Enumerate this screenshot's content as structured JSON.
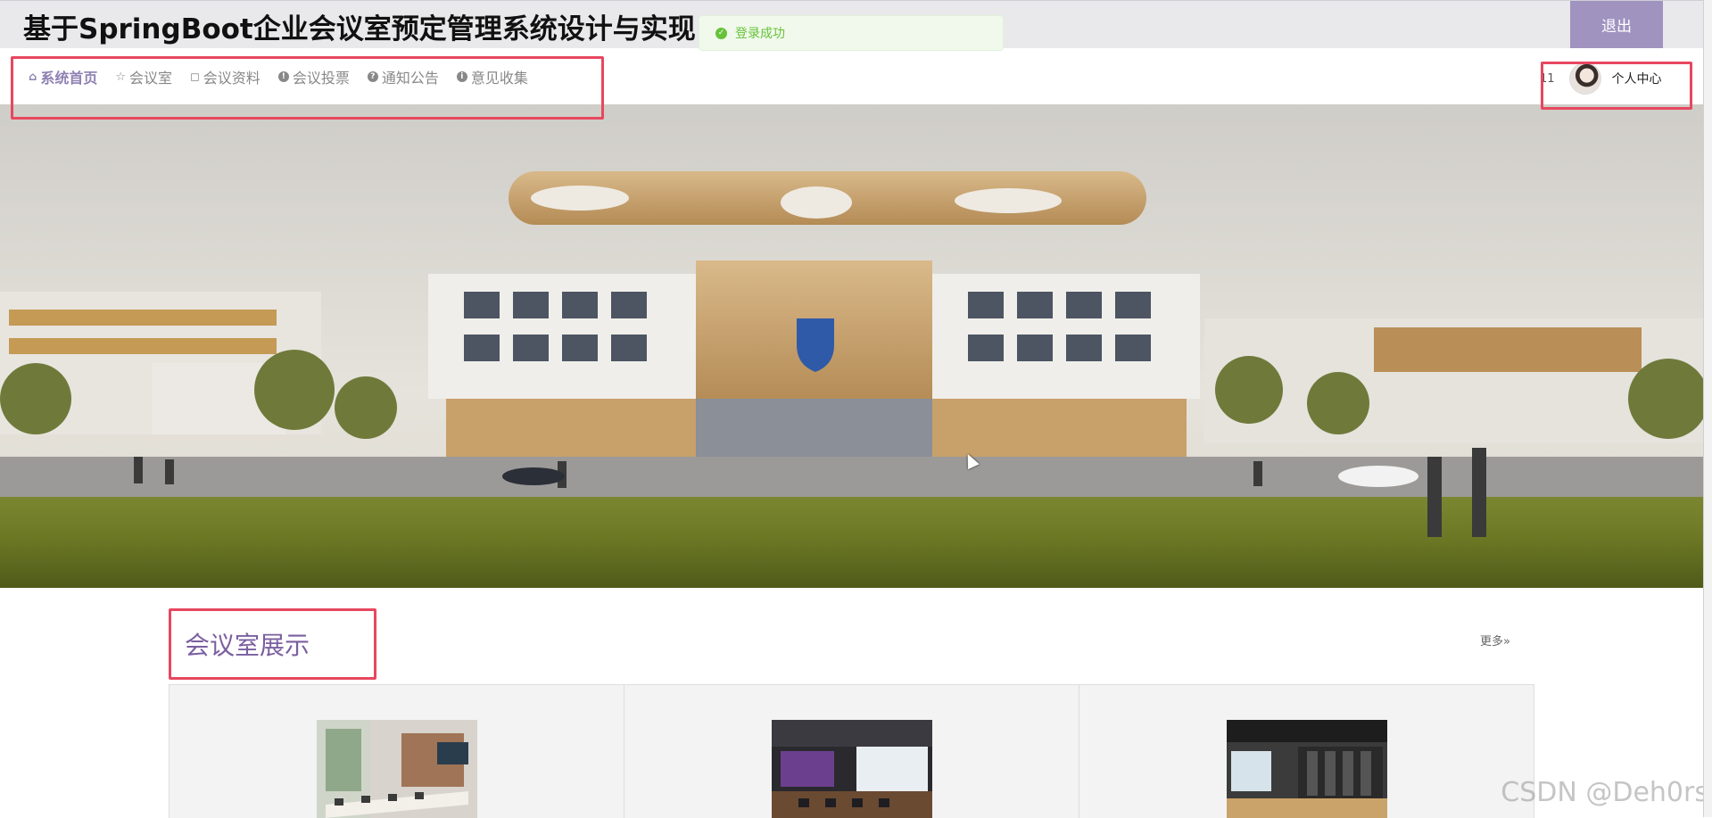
{
  "header": {
    "title": "基于SpringBoot企业会议室预定管理系统设计与实现",
    "logout_label": "退出"
  },
  "toast": {
    "message": "登录成功",
    "icon": "check-circle-icon"
  },
  "nav": {
    "items": [
      {
        "label": "系统首页",
        "icon": "home-icon",
        "active": true
      },
      {
        "label": "会议室",
        "icon": "star-icon",
        "active": false
      },
      {
        "label": "会议资料",
        "icon": "bag-icon",
        "active": false
      },
      {
        "label": "会议投票",
        "icon": "info-icon",
        "active": false
      },
      {
        "label": "通知公告",
        "icon": "question-icon",
        "active": false
      },
      {
        "label": "意见收集",
        "icon": "info-icon",
        "active": false
      }
    ]
  },
  "user": {
    "count_text": "11",
    "center_label": "个人中心"
  },
  "section": {
    "title": "会议室展示",
    "more_label": "更多»"
  },
  "watermark": "CSDN @Deh0rs",
  "colors": {
    "accent": "#8e81b3",
    "logout_bg": "#a093c0",
    "highlight": "#e8475f",
    "toast_green": "#67c23a"
  }
}
